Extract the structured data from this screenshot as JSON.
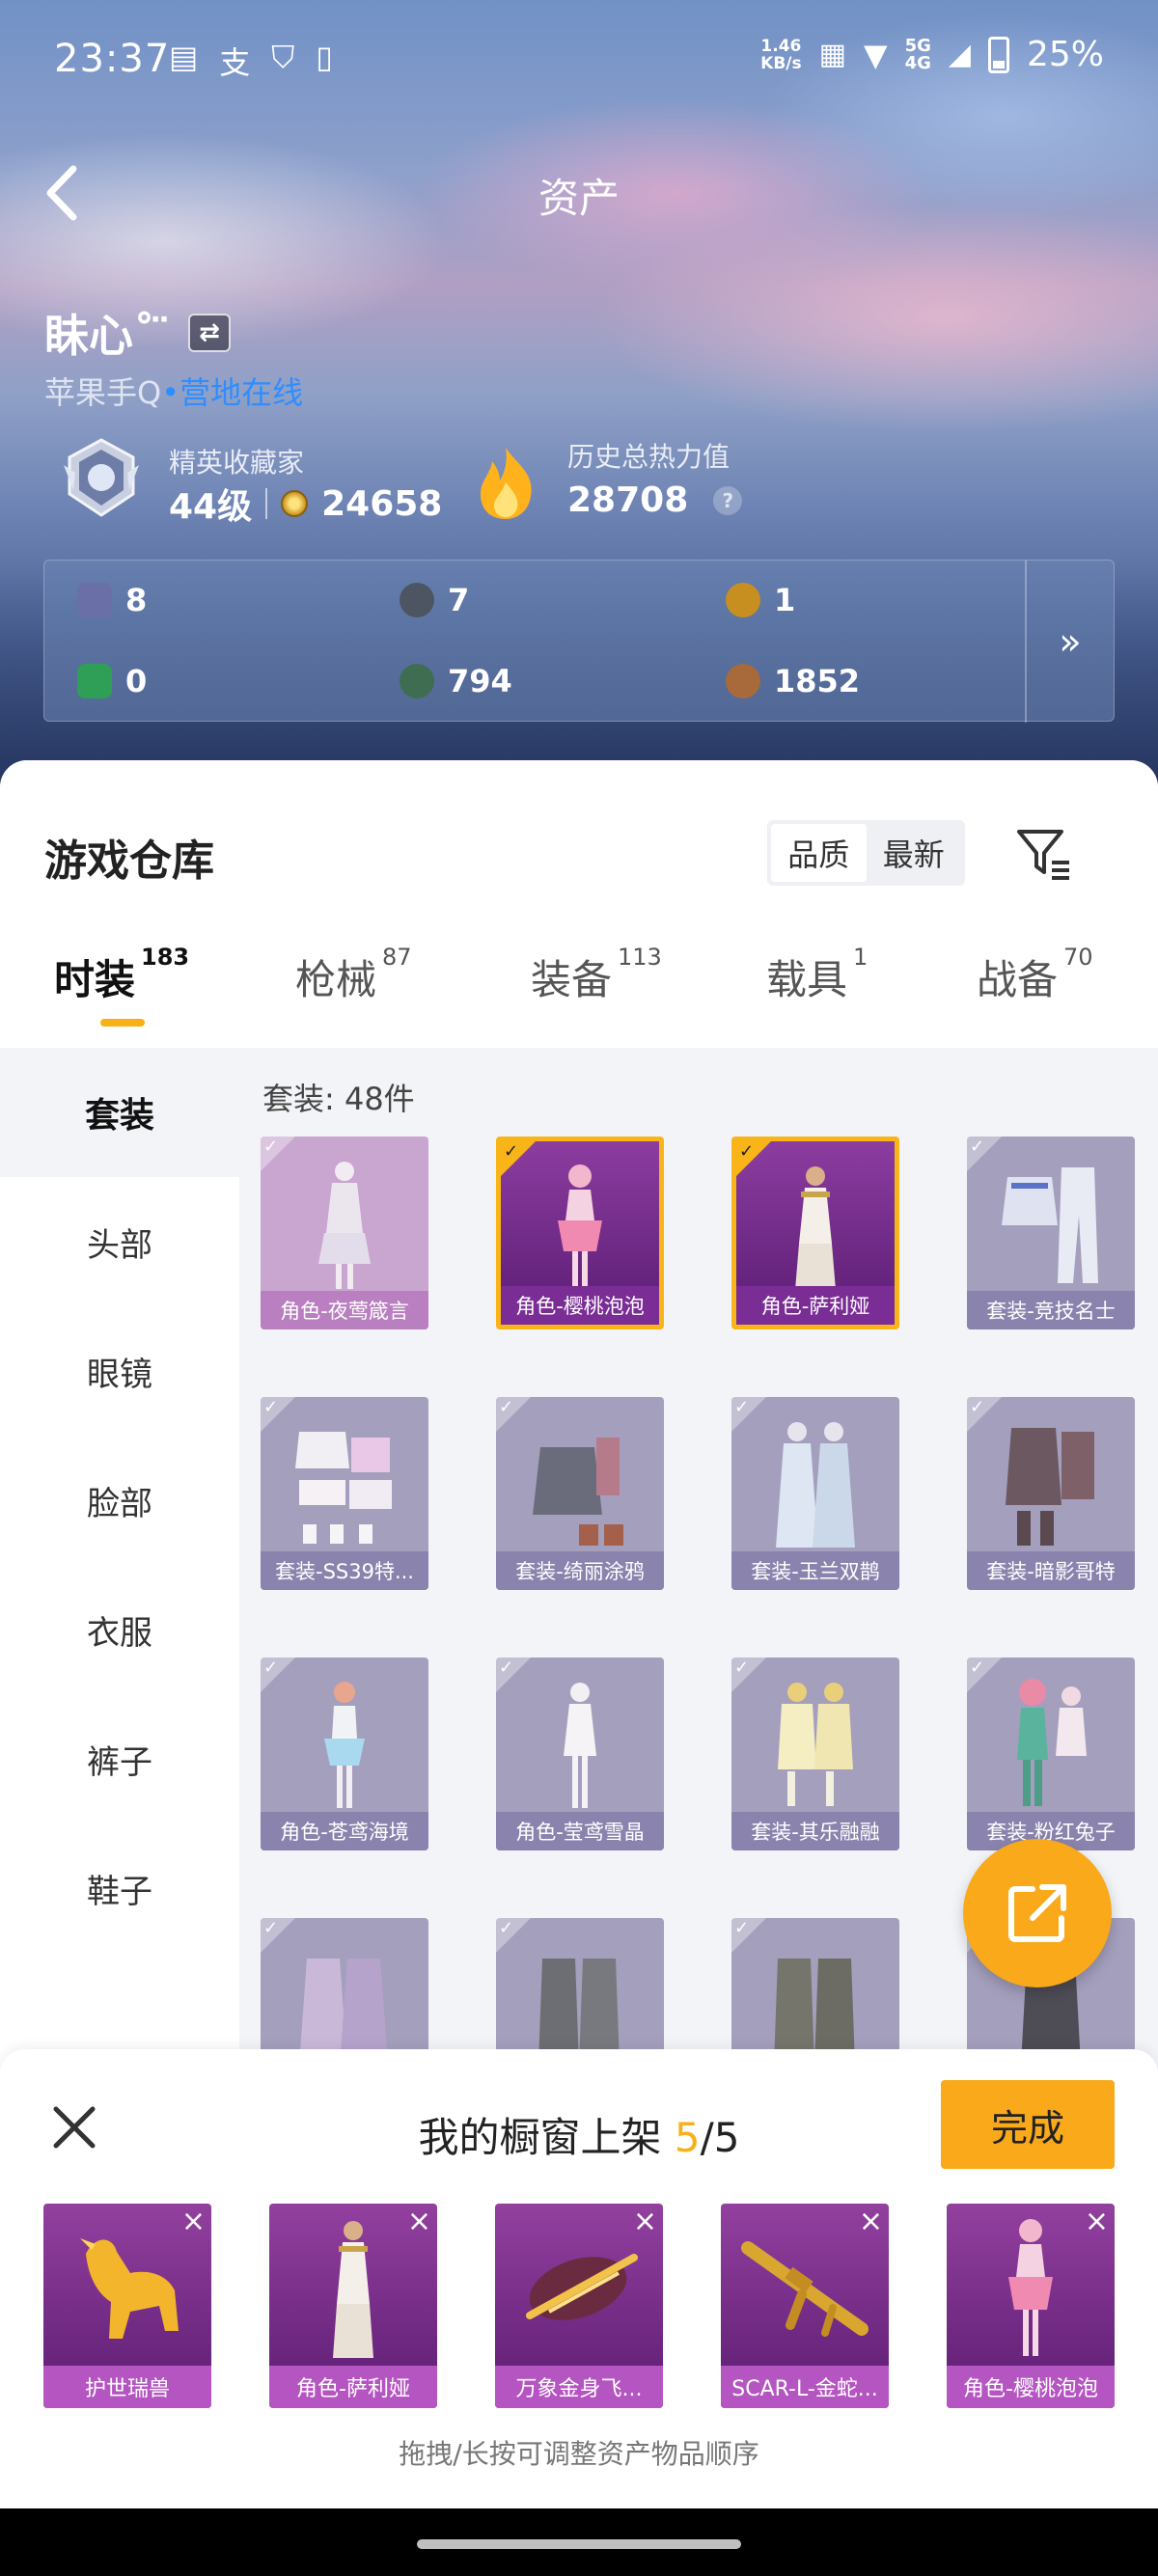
{
  "status": {
    "time": "23:37",
    "speed_top": "1.46",
    "speed_bottom": "KB/s",
    "sig_top": "5G",
    "sig_bottom": "4G",
    "battery": "25%"
  },
  "nav": {
    "title": "资产"
  },
  "profile": {
    "name": "眛心˚ ̈",
    "platform": "苹果手Q",
    "online": "•营地在线",
    "rank_label": "精英收藏家",
    "level": "44级",
    "coins": "24658",
    "heat_label": "历史总热力值",
    "heat_value": "28708",
    "help": "?"
  },
  "currencies": [
    {
      "value": "8",
      "color": "#6a6fa8"
    },
    {
      "value": "7",
      "color": "#4d5563"
    },
    {
      "value": "1",
      "color": "#c78f1f"
    },
    {
      "value": "0",
      "color": "#2f9e57"
    },
    {
      "value": "794",
      "color": "#3e6d52"
    },
    {
      "value": "1852",
      "color": "#a86a3a"
    }
  ],
  "currency_more": "»",
  "warehouse": {
    "title": "游戏仓库",
    "sort_quality": "品质",
    "sort_newest": "最新"
  },
  "tabs": [
    {
      "label": "时装",
      "count": "183"
    },
    {
      "label": "枪械",
      "count": "87"
    },
    {
      "label": "装备",
      "count": "113"
    },
    {
      "label": "载具",
      "count": "1"
    },
    {
      "label": "战备",
      "count": "70"
    }
  ],
  "side_categories": [
    "套装",
    "头部",
    "眼镜",
    "脸部",
    "衣服",
    "裤子",
    "鞋子"
  ],
  "grid": {
    "count_label": "套装: 48件",
    "items": [
      "角色-夜莺箴言",
      "角色-樱桃泡泡",
      "角色-萨利娅",
      "套装-竞技名士",
      "套装-SS39特...",
      "套装-绮丽涂鸦",
      "套装-玉兰双鹊",
      "套装-暗影哥特",
      "角色-苍鸢海境",
      "角色-莹鸢雪晶",
      "套装-其乐融融",
      "套装-粉红兔子",
      "",
      "",
      "",
      ""
    ]
  },
  "panel": {
    "title_prefix": "我的橱窗上架 ",
    "title_count": "5",
    "title_total": "/5",
    "done": "完成",
    "hint": "拖拽/长按可调整资产物品顺序",
    "items": [
      "护世瑞兽",
      "角色-萨利娅",
      "万象金身飞...",
      "SCAR-L-金蛇...",
      "角色-樱桃泡泡"
    ]
  },
  "colors": {
    "accent": "#f9a91a",
    "online": "#2f8dff",
    "selected_border": "#f9b418"
  }
}
